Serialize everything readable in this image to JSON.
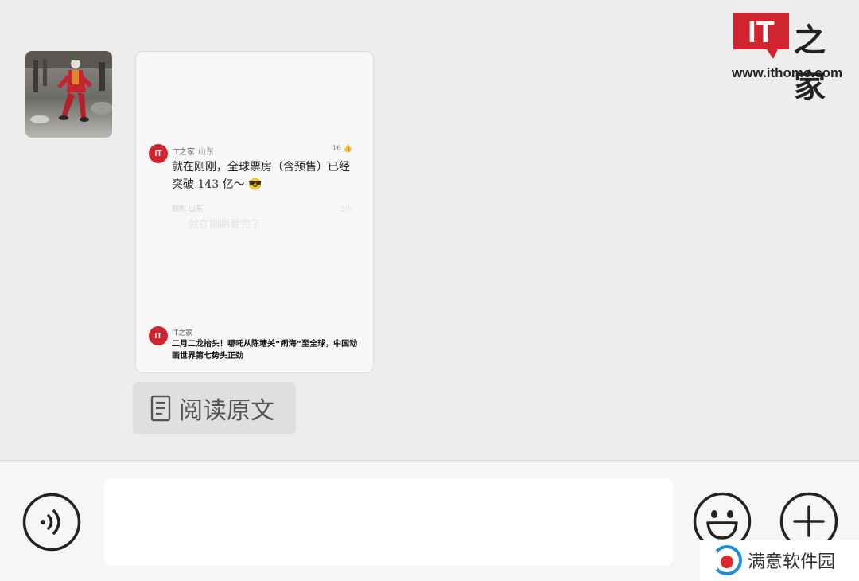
{
  "watermark": {
    "brand_chars": "IT",
    "brand_cn": "之家",
    "url": "www.ithome.com",
    "accent": "#d0242e"
  },
  "message": {
    "avatar_icon": "joker-photo-avatar",
    "card": {
      "post_badge": "IT",
      "post_author": "IT之家",
      "post_location": "山东",
      "post_likes": "16",
      "post_text": "就在刚刚，全球票房（含预售）已经突破 143 亿～ 😎",
      "faded_user": "朕附 山东",
      "faded_time": "3小",
      "faded_reply": "就在刚刚看完了",
      "source_badge": "IT",
      "source_name": "IT之家",
      "source_title": "二月二龙抬头！哪吒从陈塘关“闹海”至全球，中国动画世界第七势头正劲"
    },
    "read_original": "阅读原文"
  },
  "input_bar": {
    "voice_icon": "voice-icon",
    "input_value": "",
    "emoji_icon": "emoji-icon",
    "plus_icon": "plus-icon"
  },
  "watermark2": {
    "text": "满意软件园"
  }
}
